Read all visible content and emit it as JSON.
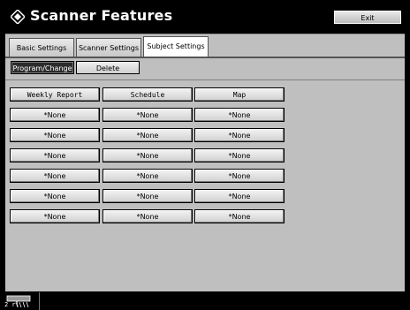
{
  "window": {
    "title": "Scanner Features",
    "exit_label": "Exit"
  },
  "tabs": [
    {
      "label": "Basic Settings",
      "active": false
    },
    {
      "label": "Scanner Settings",
      "active": false
    },
    {
      "label": "Subject Settings",
      "active": true
    }
  ],
  "modes": {
    "program_change": "Program/Change",
    "delete": "Delete",
    "selected": "program_change"
  },
  "subjects": [
    [
      "Weekly Report",
      "Schedule",
      "Map"
    ],
    [
      "*None",
      "*None",
      "*None"
    ],
    [
      "*None",
      "*None",
      "*None"
    ],
    [
      "*None",
      "*None",
      "*None"
    ],
    [
      "*None",
      "*None",
      "*None"
    ],
    [
      "*None",
      "*None",
      "*None"
    ],
    [
      "*None",
      "*None",
      "*None"
    ]
  ],
  "status": {
    "label": "2 rl"
  },
  "colors": {
    "background": "#000000",
    "panel": "#bfbfbf",
    "selected_button": "#2b2b2b"
  }
}
